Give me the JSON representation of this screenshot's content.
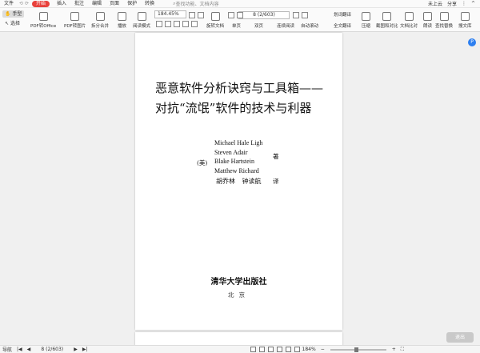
{
  "menu": {
    "items": [
      "文件",
      "开始",
      "插入",
      "批注",
      "编辑",
      "页面",
      "保护",
      "转换"
    ],
    "active": "开始",
    "search_placeholder": "查找功能、文档内容",
    "cloud": "未上云",
    "share": "分享"
  },
  "toolbar": {
    "hand_tool": "手型",
    "select_tool": "选择",
    "buttons": [
      "PDF转Office",
      "PDF转图片",
      "拆分合并",
      "播放",
      "阅读模式",
      "旋转文档",
      "单页",
      "双页",
      "连续阅读",
      "自动滚动",
      "划词翻译",
      "全文翻译",
      "压缩",
      "截图和对比",
      "文档比对",
      "朗读",
      "查找替换",
      "搜文库"
    ],
    "zoom": "184.45%",
    "page_indicator": "8 (2/603)"
  },
  "document": {
    "title_line1": "恶意软件分析诀窍与工具箱——",
    "title_line2": "对抗“流氓”软件的技术与利器",
    "authors": [
      "Michael Hale Ligh",
      "Steven Adair",
      "Blake Hartstein",
      "Matthew Richard"
    ],
    "country": "(美)",
    "author_suffix": "著",
    "translators": "胡乔林  钟读航",
    "translator_suffix": "译",
    "publisher": "清华大学出版社",
    "city": "北京"
  },
  "side_badge": "P",
  "exit_button": "退出",
  "status": {
    "nav": "导航",
    "page": "8 (2/603)",
    "zoom": "184%"
  }
}
